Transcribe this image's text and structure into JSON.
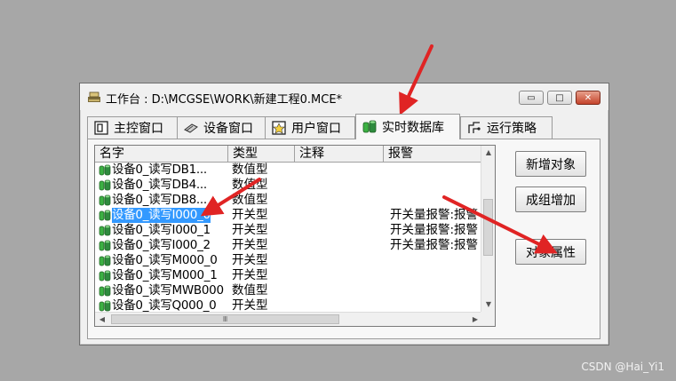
{
  "window": {
    "title": "工作台 : D:\\MCGSE\\WORK\\新建工程0.MCE*",
    "minimize_glyph": "▭",
    "maximize_glyph": "□",
    "close_glyph": "✕"
  },
  "tabs": [
    {
      "label": "主控窗口",
      "icon": "main-window-icon"
    },
    {
      "label": "设备窗口",
      "icon": "device-window-icon"
    },
    {
      "label": "用户窗口",
      "icon": "user-window-icon"
    },
    {
      "label": "实时数据库",
      "icon": "database-icon",
      "active": true
    },
    {
      "label": "运行策略",
      "icon": "strategy-icon"
    }
  ],
  "table": {
    "columns": [
      "名字",
      "类型",
      "注释",
      "报警"
    ],
    "rows": [
      {
        "name": "设备0_读写DB1...",
        "type": "数值型",
        "note": "",
        "alarm": ""
      },
      {
        "name": "设备0_读写DB4...",
        "type": "数值型",
        "note": "",
        "alarm": ""
      },
      {
        "name": "设备0_读写DB8...",
        "type": "数值型",
        "note": "",
        "alarm": ""
      },
      {
        "name": "设备0_读写I000_0",
        "type": "开关型",
        "note": "",
        "alarm": "开关量报警:报警",
        "selected": true
      },
      {
        "name": "设备0_读写I000_1",
        "type": "开关型",
        "note": "",
        "alarm": "开关量报警:报警"
      },
      {
        "name": "设备0_读写I000_2",
        "type": "开关型",
        "note": "",
        "alarm": "开关量报警:报警"
      },
      {
        "name": "设备0_读写M000_0",
        "type": "开关型",
        "note": "",
        "alarm": ""
      },
      {
        "name": "设备0_读写M000_1",
        "type": "开关型",
        "note": "",
        "alarm": ""
      },
      {
        "name": "设备0_读写MWB000",
        "type": "数值型",
        "note": "",
        "alarm": ""
      },
      {
        "name": "设备0_读写Q000_0",
        "type": "开关型",
        "note": "",
        "alarm": ""
      }
    ]
  },
  "buttons": {
    "new_object": "新增对象",
    "group_add": "成组增加",
    "object_properties": "对象属性"
  },
  "scroll": {
    "hthumb_glyph": "Ⅲ"
  },
  "watermark": "CSDN @Hai_Yi1",
  "colors": {
    "selection": "#3399ff",
    "arrow": "#e02424",
    "background": "#a7a7a7"
  }
}
